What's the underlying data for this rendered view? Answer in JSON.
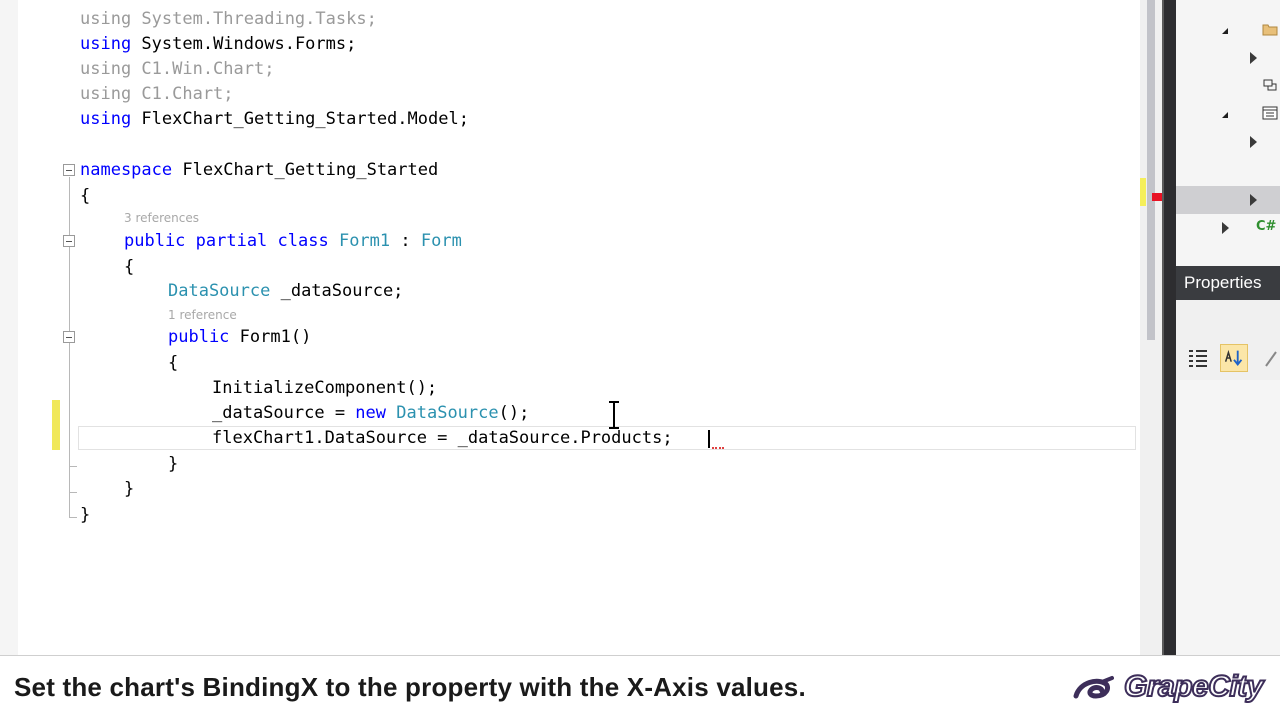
{
  "editor": {
    "lines": [
      {
        "tokens": [
          {
            "t": "using System.Threading.Tasks;",
            "c": "dim"
          }
        ]
      },
      {
        "tokens": [
          {
            "t": "using",
            "c": "kw"
          },
          {
            "t": " System.Windows.Forms;",
            "c": ""
          }
        ]
      },
      {
        "tokens": [
          {
            "t": "using C1.Win.Chart;",
            "c": "dim"
          }
        ]
      },
      {
        "tokens": [
          {
            "t": "using C1.Chart;",
            "c": "dim"
          }
        ]
      },
      {
        "tokens": [
          {
            "t": "using",
            "c": "kw"
          },
          {
            "t": " FlexChart_Getting_Started.Model;",
            "c": ""
          }
        ]
      },
      {
        "tokens": [
          {
            "t": "namespace",
            "c": "kw"
          },
          {
            "t": " FlexChart_Getting_Started",
            "c": ""
          }
        ]
      },
      {
        "tokens": [
          {
            "t": "{",
            "c": ""
          }
        ]
      },
      {
        "tokens": [
          {
            "t": "public partial class",
            "c": "kw"
          },
          {
            "t": " ",
            "c": ""
          },
          {
            "t": "Form1",
            "c": "ty"
          },
          {
            "t": " : ",
            "c": ""
          },
          {
            "t": "Form",
            "c": "ty"
          }
        ]
      },
      {
        "tokens": [
          {
            "t": "{",
            "c": ""
          }
        ]
      },
      {
        "tokens": [
          {
            "t": "DataSource",
            "c": "ty"
          },
          {
            "t": " _dataSource;",
            "c": ""
          }
        ]
      },
      {
        "tokens": [
          {
            "t": "public",
            "c": "kw"
          },
          {
            "t": " Form1()",
            "c": ""
          }
        ]
      },
      {
        "tokens": [
          {
            "t": "{",
            "c": ""
          }
        ]
      },
      {
        "tokens": [
          {
            "t": "InitializeComponent();",
            "c": ""
          }
        ]
      },
      {
        "tokens": [
          {
            "t": "_dataSource = ",
            "c": ""
          },
          {
            "t": "new",
            "c": "kw"
          },
          {
            "t": " ",
            "c": ""
          },
          {
            "t": "DataSource",
            "c": "ty"
          },
          {
            "t": "();",
            "c": ""
          }
        ]
      },
      {
        "tokens": [
          {
            "t": "flexChart1.DataSource = _dataSource.Products;",
            "c": ""
          }
        ]
      },
      {
        "tokens": [
          {
            "t": "}",
            "c": ""
          }
        ]
      },
      {
        "tokens": [
          {
            "t": "}",
            "c": ""
          }
        ]
      },
      {
        "tokens": [
          {
            "t": "}",
            "c": ""
          }
        ]
      }
    ],
    "codelens": {
      "class_refs": "3 references",
      "ctor_refs": "1 reference"
    }
  },
  "right_pane": {
    "language_badge": "C#",
    "properties_title": "Properties"
  },
  "caption": {
    "text": "Set the chart's BindingX to the property with the X-Axis values.",
    "brand": "GrapeCity"
  },
  "colors": {
    "keyword": "#0000ff",
    "type": "#2b91af",
    "brand": "#3d2e5a"
  }
}
